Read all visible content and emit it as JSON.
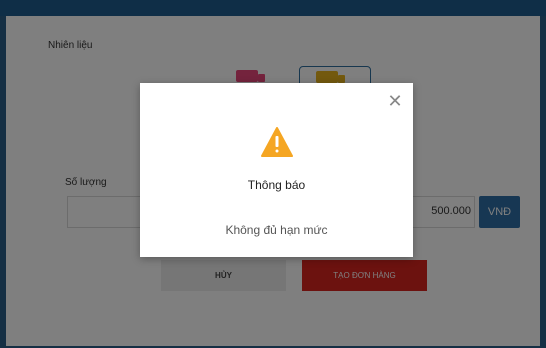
{
  "form": {
    "fuel_label": "Nhiên liệu",
    "quantity_label": "Số lượng",
    "amount_value": "500.000",
    "currency_label": "VNĐ",
    "cancel_label": "HỦY",
    "order_label": "TẠO ĐƠN HÀNG"
  },
  "fuel_options": [
    {
      "icon": "truck-icon",
      "color": "#e8467b",
      "selected": false
    },
    {
      "icon": "truck-icon",
      "color": "#e6b21d",
      "selected": true
    }
  ],
  "dialog": {
    "close_icon": "close-icon",
    "icon": "warning-icon",
    "icon_color": "#f5a623",
    "title": "Thông báo",
    "message": "Không đủ hạn mức"
  },
  "colors": {
    "primary": "#2f6fa7",
    "danger": "#d9241f",
    "header": "#1f5d8f"
  }
}
